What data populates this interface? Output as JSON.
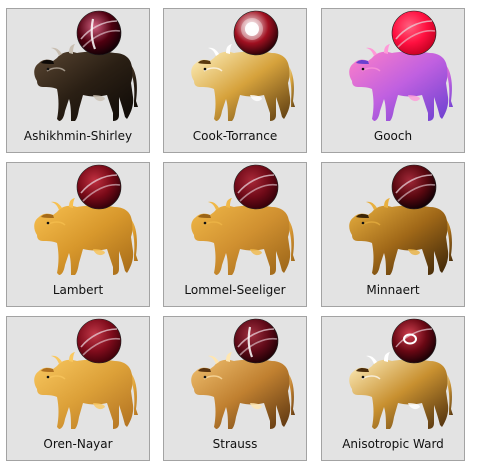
{
  "shaders": [
    {
      "label": "Ashikhmin-Shirley",
      "cow": [
        "#5a4632",
        "#2a1f14",
        "#0d0906",
        "#c9bfb2"
      ],
      "sphere": [
        "#d06080",
        "#500010",
        "#0a0004"
      ],
      "highlight": "streak"
    },
    {
      "label": "Cook-Torrance",
      "cow": [
        "#fff2c0",
        "#d6a23c",
        "#5a3a10",
        "#ffffff"
      ],
      "sphere": [
        "#ffffff",
        "#a01020",
        "#1a0004"
      ],
      "highlight": "spot"
    },
    {
      "label": "Gooch",
      "cow": [
        "#ff80c8",
        "#c060e0",
        "#6a40d0",
        "#ff9ad8"
      ],
      "sphere": [
        "#ff6080",
        "#ff1040",
        "#c00020"
      ],
      "highlight": "bands"
    },
    {
      "label": "Lambert",
      "cow": [
        "#f7c050",
        "#d8982c",
        "#a56a18",
        "#f7c050"
      ],
      "sphere": [
        "#c03040",
        "#7a0a18",
        "#2a0008"
      ],
      "highlight": "bands"
    },
    {
      "label": "Lommel-Seeliger",
      "cow": [
        "#f0b848",
        "#d09030",
        "#9a6418",
        "#f0b848"
      ],
      "sphere": [
        "#a82838",
        "#700a18",
        "#300008"
      ],
      "highlight": "bands"
    },
    {
      "label": "Minnaert",
      "cow": [
        "#e8b040",
        "#a06818",
        "#3a2408",
        "#e8b040"
      ],
      "sphere": [
        "#a02838",
        "#5a0810",
        "#0a0004"
      ],
      "highlight": "bands"
    },
    {
      "label": "Oren-Nayar",
      "cow": [
        "#f9c860",
        "#dca038",
        "#b07020",
        "#f9c860"
      ],
      "sphere": [
        "#c03848",
        "#800c1c",
        "#3a0008"
      ],
      "highlight": "bands"
    },
    {
      "label": "Strauss",
      "cow": [
        "#f0c070",
        "#c08030",
        "#5a3410",
        "#ffe6b0"
      ],
      "sphere": [
        "#a03040",
        "#600a18",
        "#1a0004"
      ],
      "highlight": "streak"
    },
    {
      "label": "Anisotropic Ward",
      "cow": [
        "#fff0c0",
        "#c89030",
        "#4a2c0c",
        "#ffffff"
      ],
      "sphere": [
        "#d04050",
        "#6a0814",
        "#120004"
      ],
      "highlight": "ring"
    }
  ]
}
